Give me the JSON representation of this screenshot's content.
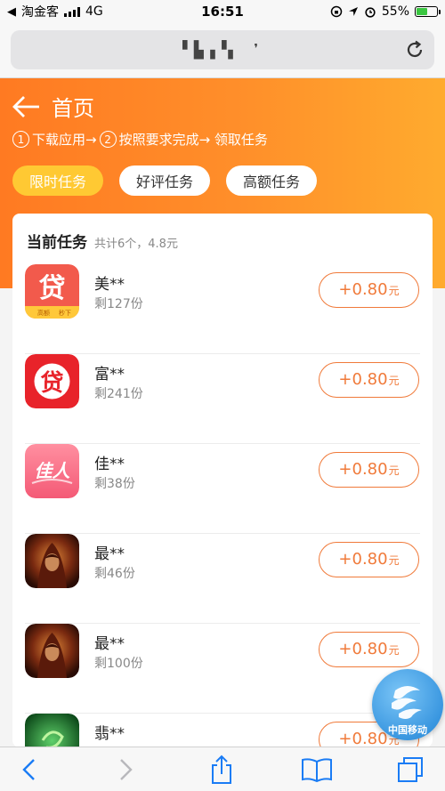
{
  "status_bar": {
    "carrier": "淘金客",
    "network": "4G",
    "time": "16:51",
    "battery": "55%",
    "battery_level": 0.55
  },
  "browser": {
    "url": "▘▙▗▝▖ ❜"
  },
  "header": {
    "title": "首页",
    "steps": [
      {
        "num": "1",
        "text": "下载应用→"
      },
      {
        "num": "2",
        "text": "按照要求完成→ 领取任务"
      }
    ],
    "tabs": [
      {
        "label": "限时任务",
        "active": true
      },
      {
        "label": "好评任务",
        "active": false
      },
      {
        "label": "高额任务",
        "active": false
      }
    ]
  },
  "tasks_card": {
    "title": "当前任务",
    "summary": "共计6个，4.8元",
    "tasks": [
      {
        "name": "美**",
        "remaining": "剩127份",
        "reward": "+0.80",
        "unit": "元",
        "icon": "loan-app-icon"
      },
      {
        "name": "富**",
        "remaining": "剩241份",
        "reward": "+0.80",
        "unit": "元",
        "icon": "loan-red-app-icon"
      },
      {
        "name": "佳**",
        "remaining": "剩38份",
        "reward": "+0.80",
        "unit": "元",
        "icon": "jiaren-app-icon"
      },
      {
        "name": "最**",
        "remaining": "剩46份",
        "reward": "+0.80",
        "unit": "元",
        "icon": "game-app-icon"
      },
      {
        "name": "最**",
        "remaining": "剩100份",
        "reward": "+0.80",
        "unit": "元",
        "icon": "game-app-icon"
      },
      {
        "name": "翡**",
        "remaining": "",
        "reward": "+0.80",
        "unit": "元",
        "icon": "jade-app-icon"
      }
    ]
  },
  "float_badge": {
    "label": "中国移动",
    "icon": "china-mobile-icon"
  },
  "toolbar": {
    "icons": [
      "back-icon",
      "forward-icon",
      "share-icon",
      "bookmarks-icon",
      "tabs-icon"
    ]
  },
  "colors": {
    "orange_start": "#ff7a22",
    "orange_end": "#ffab2e",
    "active_tab": "#ffc933",
    "reward": "#f07a3a",
    "ios_blue": "#1a7cf5"
  }
}
